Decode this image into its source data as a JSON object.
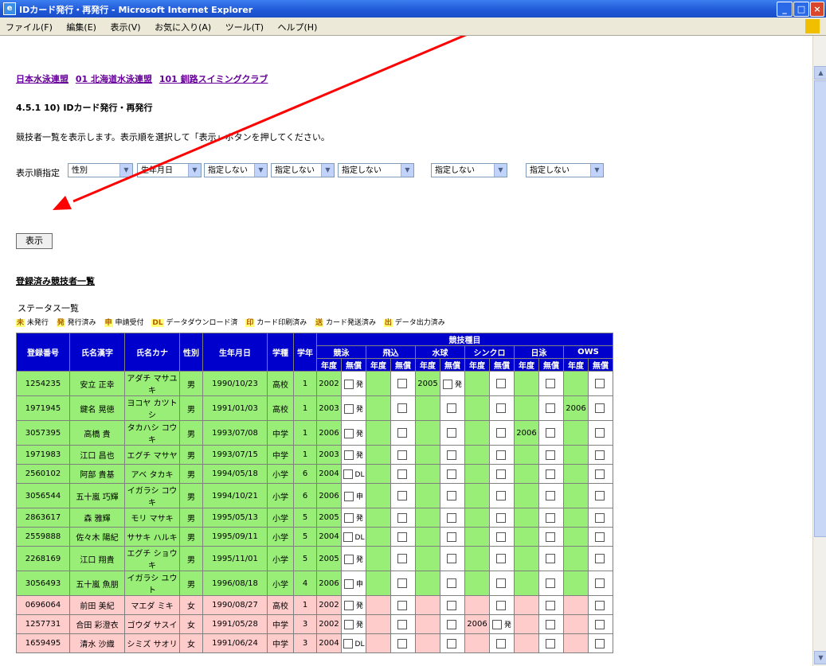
{
  "window": {
    "title": "IDカード発行・再発行 - Microsoft Internet Explorer",
    "btn_min": "_",
    "btn_max": "□",
    "btn_close": "×"
  },
  "menu": [
    "ファイル(F)",
    "編集(E)",
    "表示(V)",
    "お気に入り(A)",
    "ツール(T)",
    "ヘルプ(H)"
  ],
  "breadcrumbs": [
    "日本水泳連盟",
    "01 北海道水泳連盟",
    "101 釧路スイミングクラブ"
  ],
  "heading": "4.5.1 10) IDカード発行・再発行",
  "description": "競技者一覧を表示します。表示順を選択して「表示」ボタンを押してください。",
  "order": {
    "label": "表示順指定",
    "selects": [
      "性別",
      "生年月日",
      "指定しない",
      "指定しない",
      "指定しない",
      "指定しない",
      "指定しない"
    ],
    "arrow": "▼"
  },
  "show_button": "表示",
  "list_title": "登録済み競技者一覧",
  "status_label": "ステータス一覧",
  "legend": [
    {
      "mark": "未",
      "text": "未発行"
    },
    {
      "mark": "発",
      "text": "発行済み"
    },
    {
      "mark": "申",
      "text": "申請受付"
    },
    {
      "mark": "DL",
      "text": "データダウンロード済"
    },
    {
      "mark": "印",
      "text": "カード印刷済み"
    },
    {
      "mark": "送",
      "text": "カード発送済み"
    },
    {
      "mark": "出",
      "text": "データ出力済み"
    }
  ],
  "table": {
    "headers": [
      "登録番号",
      "氏名漢字",
      "氏名カナ",
      "性別",
      "生年月日",
      "学種",
      "学年"
    ],
    "group": "競技種目",
    "events": [
      "競泳",
      "飛込",
      "水球",
      "シンクロ",
      "日泳",
      "OWS"
    ],
    "subheaders": [
      "年度",
      "無償"
    ],
    "rows": [
      {
        "id": "1254235",
        "kanji": "安立 正幸",
        "kana": "アダチ マサユキ",
        "sex": "男",
        "dob": "1990/10/23",
        "school": "高校",
        "grade": "1",
        "events": [
          {
            "year": "2002",
            "status": "発"
          },
          {
            "year": "",
            "status": ""
          },
          {
            "year": "2005",
            "status": "発"
          },
          {
            "year": "",
            "status": ""
          },
          {
            "year": "",
            "status": ""
          },
          {
            "year": "",
            "status": ""
          }
        ]
      },
      {
        "id": "1971945",
        "kanji": "鍵名 晃徳",
        "kana": "ヨコヤ カツトシ",
        "sex": "男",
        "dob": "1991/01/03",
        "school": "高校",
        "grade": "1",
        "events": [
          {
            "year": "2003",
            "status": "発"
          },
          {
            "year": "",
            "status": ""
          },
          {
            "year": "",
            "status": ""
          },
          {
            "year": "",
            "status": ""
          },
          {
            "year": "",
            "status": ""
          },
          {
            "year": "2006",
            "status": ""
          }
        ]
      },
      {
        "id": "3057395",
        "kanji": "高橋 貴",
        "kana": "タカハシ コウキ",
        "sex": "男",
        "dob": "1993/07/08",
        "school": "中学",
        "grade": "1",
        "events": [
          {
            "year": "2006",
            "status": "発"
          },
          {
            "year": "",
            "status": ""
          },
          {
            "year": "",
            "status": ""
          },
          {
            "year": "",
            "status": ""
          },
          {
            "year": "2006",
            "status": ""
          },
          {
            "year": "",
            "status": ""
          }
        ]
      },
      {
        "id": "1971983",
        "kanji": "江口 昌也",
        "kana": "エグチ マサヤ",
        "sex": "男",
        "dob": "1993/07/15",
        "school": "中学",
        "grade": "1",
        "events": [
          {
            "year": "2003",
            "status": "発"
          },
          {
            "year": "",
            "status": ""
          },
          {
            "year": "",
            "status": ""
          },
          {
            "year": "",
            "status": ""
          },
          {
            "year": "",
            "status": ""
          },
          {
            "year": "",
            "status": ""
          }
        ]
      },
      {
        "id": "2560102",
        "kanji": "阿部 貴基",
        "kana": "アベ タカキ",
        "sex": "男",
        "dob": "1994/05/18",
        "school": "小学",
        "grade": "6",
        "events": [
          {
            "year": "2004",
            "status": "DL"
          },
          {
            "year": "",
            "status": ""
          },
          {
            "year": "",
            "status": ""
          },
          {
            "year": "",
            "status": ""
          },
          {
            "year": "",
            "status": ""
          },
          {
            "year": "",
            "status": ""
          }
        ]
      },
      {
        "id": "3056544",
        "kanji": "五十嵐 巧輝",
        "kana": "イガラシ コウキ",
        "sex": "男",
        "dob": "1994/10/21",
        "school": "小学",
        "grade": "6",
        "events": [
          {
            "year": "2006",
            "status": "申"
          },
          {
            "year": "",
            "status": ""
          },
          {
            "year": "",
            "status": ""
          },
          {
            "year": "",
            "status": ""
          },
          {
            "year": "",
            "status": ""
          },
          {
            "year": "",
            "status": ""
          }
        ]
      },
      {
        "id": "2863617",
        "kanji": "森 雅輝",
        "kana": "モリ マサキ",
        "sex": "男",
        "dob": "1995/05/13",
        "school": "小学",
        "grade": "5",
        "events": [
          {
            "year": "2005",
            "status": "発"
          },
          {
            "year": "",
            "status": ""
          },
          {
            "year": "",
            "status": ""
          },
          {
            "year": "",
            "status": ""
          },
          {
            "year": "",
            "status": ""
          },
          {
            "year": "",
            "status": ""
          }
        ]
      },
      {
        "id": "2559888",
        "kanji": "佐々木 陽紀",
        "kana": "ササキ ハルキ",
        "sex": "男",
        "dob": "1995/09/11",
        "school": "小学",
        "grade": "5",
        "events": [
          {
            "year": "2004",
            "status": "DL"
          },
          {
            "year": "",
            "status": ""
          },
          {
            "year": "",
            "status": ""
          },
          {
            "year": "",
            "status": ""
          },
          {
            "year": "",
            "status": ""
          },
          {
            "year": "",
            "status": ""
          }
        ]
      },
      {
        "id": "2268169",
        "kanji": "江口 翔貴",
        "kana": "エグチ ショウキ",
        "sex": "男",
        "dob": "1995/11/01",
        "school": "小学",
        "grade": "5",
        "events": [
          {
            "year": "2005",
            "status": "発"
          },
          {
            "year": "",
            "status": ""
          },
          {
            "year": "",
            "status": ""
          },
          {
            "year": "",
            "status": ""
          },
          {
            "year": "",
            "status": ""
          },
          {
            "year": "",
            "status": ""
          }
        ]
      },
      {
        "id": "3056493",
        "kanji": "五十嵐 魚朋",
        "kana": "イガラシ ユウト",
        "sex": "男",
        "dob": "1996/08/18",
        "school": "小学",
        "grade": "4",
        "events": [
          {
            "year": "2006",
            "status": "申"
          },
          {
            "year": "",
            "status": ""
          },
          {
            "year": "",
            "status": ""
          },
          {
            "year": "",
            "status": ""
          },
          {
            "year": "",
            "status": ""
          },
          {
            "year": "",
            "status": ""
          }
        ]
      },
      {
        "id": "0696064",
        "kanji": "前田 美紀",
        "kana": "マエダ ミキ",
        "sex": "女",
        "dob": "1990/08/27",
        "school": "高校",
        "grade": "1",
        "events": [
          {
            "year": "2002",
            "status": "発"
          },
          {
            "year": "",
            "status": ""
          },
          {
            "year": "",
            "status": ""
          },
          {
            "year": "",
            "status": ""
          },
          {
            "year": "",
            "status": ""
          },
          {
            "year": "",
            "status": ""
          }
        ]
      },
      {
        "id": "1257731",
        "kanji": "合田 彩澄衣",
        "kana": "ゴウダ サスイ",
        "sex": "女",
        "dob": "1991/05/28",
        "school": "中学",
        "grade": "3",
        "events": [
          {
            "year": "2002",
            "status": "発"
          },
          {
            "year": "",
            "status": ""
          },
          {
            "year": "",
            "status": ""
          },
          {
            "year": "2006",
            "status": "発"
          },
          {
            "year": "",
            "status": ""
          },
          {
            "year": "",
            "status": ""
          }
        ]
      },
      {
        "id": "1659495",
        "kanji": "清水 沙織",
        "kana": "シミズ サオリ",
        "sex": "女",
        "dob": "1991/06/24",
        "school": "中学",
        "grade": "3",
        "events": [
          {
            "year": "2004",
            "status": "DL"
          },
          {
            "year": "",
            "status": ""
          },
          {
            "year": "",
            "status": ""
          },
          {
            "year": "",
            "status": ""
          },
          {
            "year": "",
            "status": ""
          },
          {
            "year": "",
            "status": ""
          }
        ]
      }
    ]
  },
  "colors": {
    "header_blue": "#0000cc",
    "male_row": "#99ee77",
    "female_row": "#ffcccc",
    "annotation_arrow": "#ff0000"
  }
}
